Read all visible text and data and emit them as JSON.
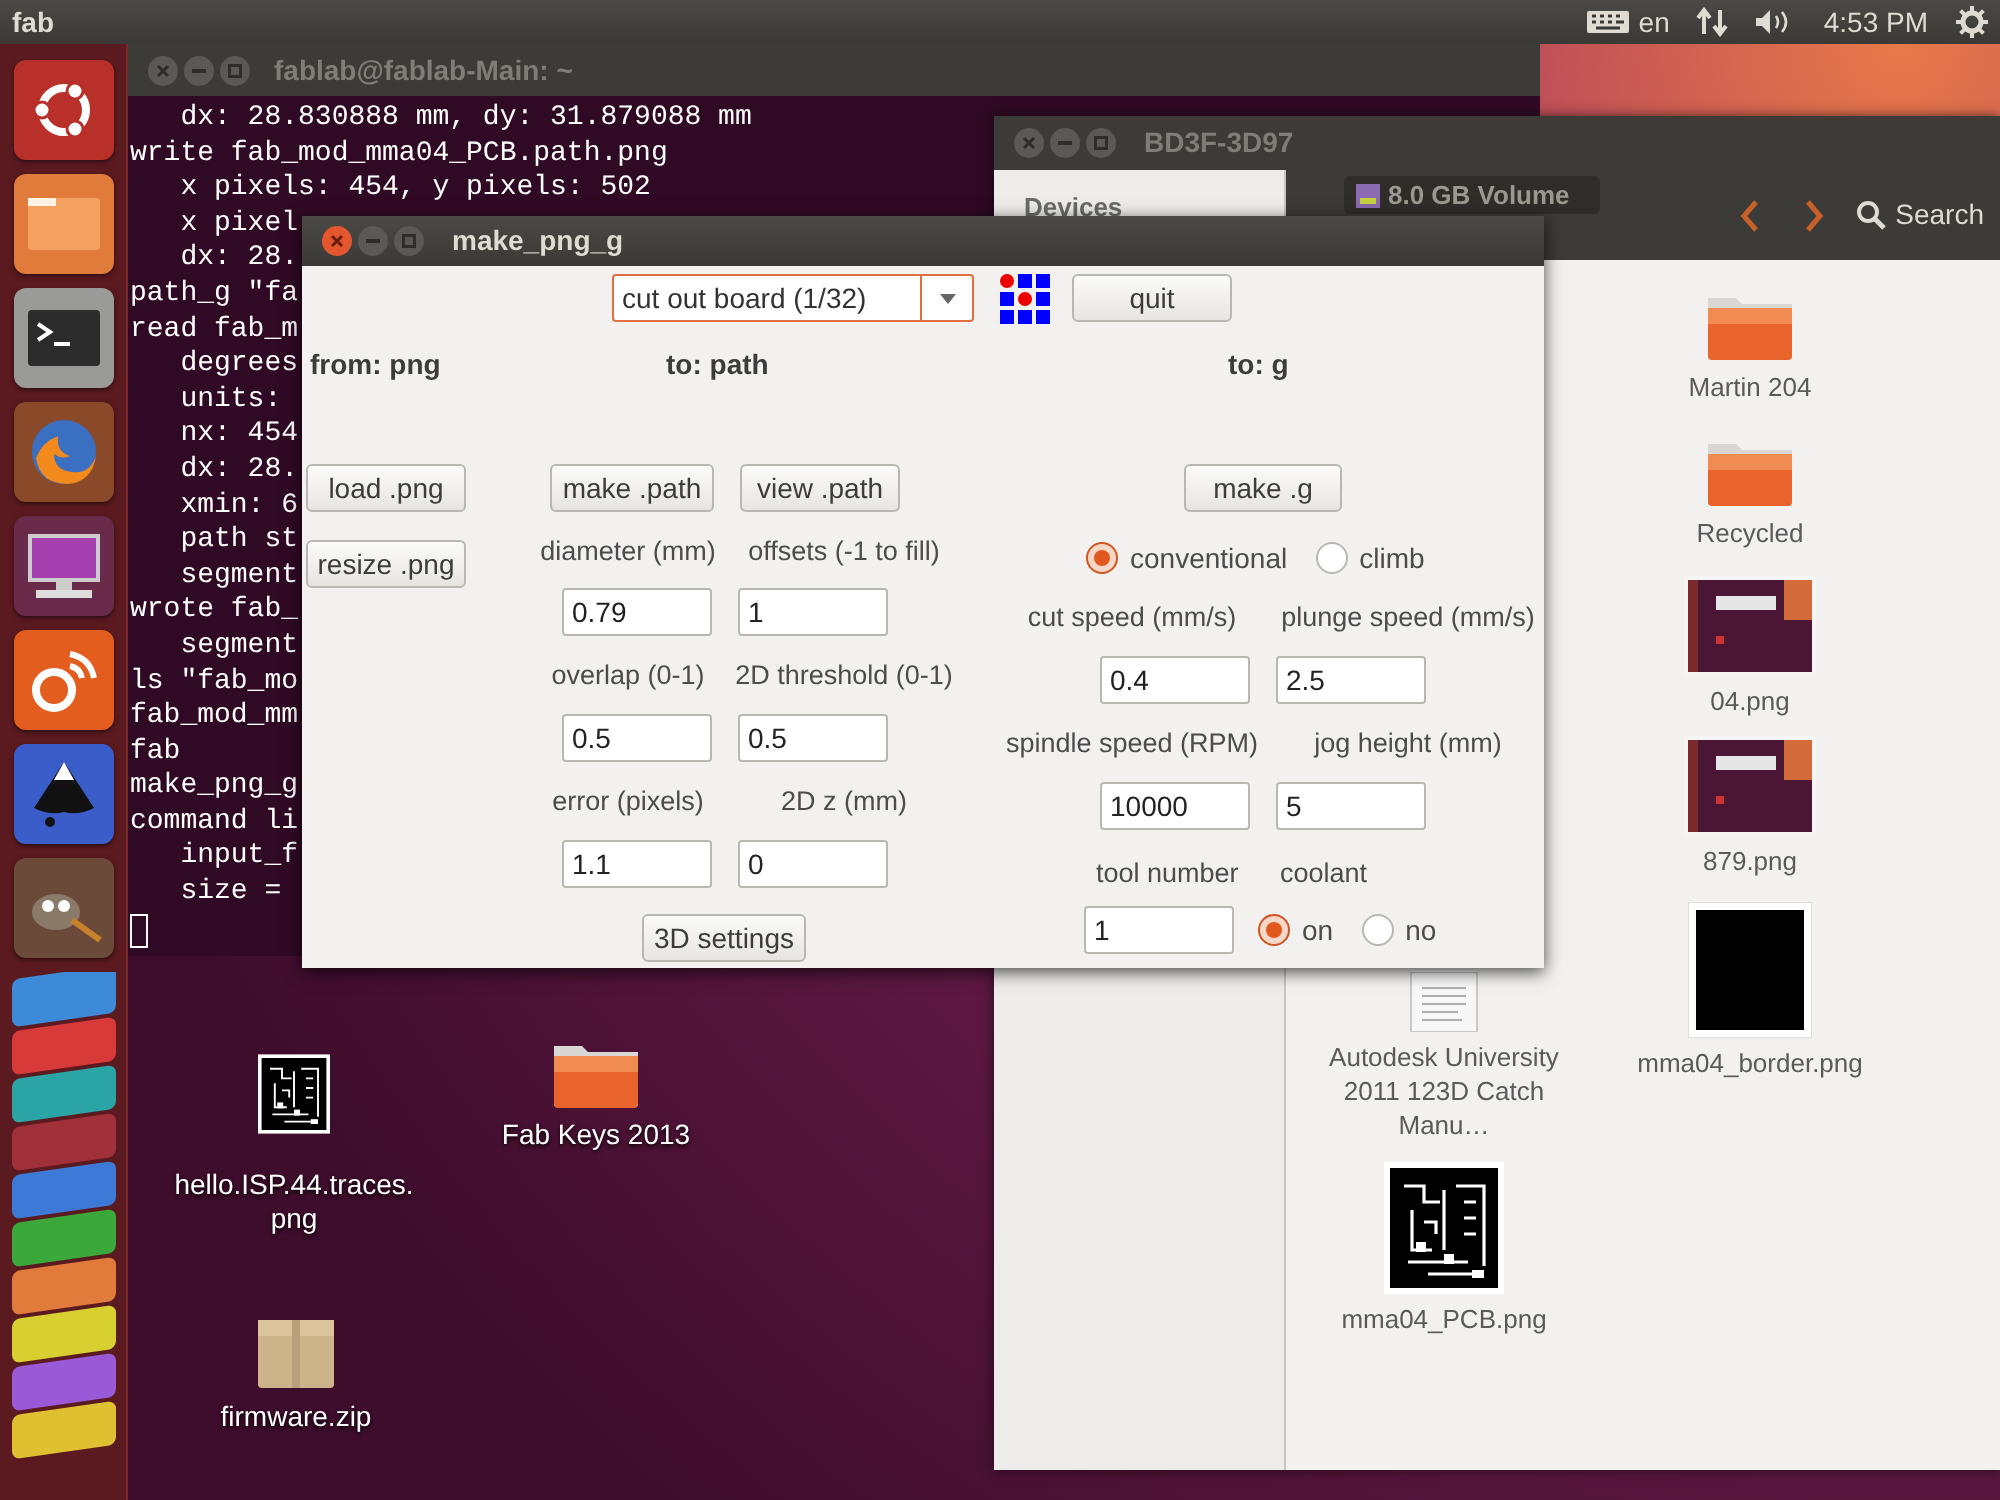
{
  "top_panel": {
    "title": "fab",
    "language": "en",
    "time": "4:53 PM"
  },
  "terminal": {
    "title": "fablab@fablab-Main: ~",
    "lines": [
      "   dx: 28.830888 mm, dy: 31.879088 mm",
      "write fab_mod_mma04_PCB.path.png",
      "   x pixels: 454, y pixels: 502",
      "   x pixel",
      "   dx: 28.",
      "path_g \"fa",
      "read fab_m",
      "   degrees",
      "   units:",
      "   nx: 454",
      "   dx: 28.",
      "   xmin: 6",
      "   path st",
      "   segment",
      "wrote fab_",
      "   segment",
      "ls \"fab_mo",
      "fab_mod_mm",
      "fab",
      "make_png_g",
      "command li",
      "   input_f",
      "   size ="
    ]
  },
  "file_manager": {
    "title": "BD3F-3D97",
    "sidebar_heading": "Devices",
    "location": "8.0 GB Volume",
    "search": "Search",
    "files": [
      {
        "name": "Martin 204",
        "kind": "folder"
      },
      {
        "name": "Recycled",
        "kind": "folder"
      },
      {
        "name": "04.png",
        "kind": "screenshot"
      },
      {
        "name": "879.png",
        "kind": "screenshot"
      },
      {
        "name": "Autodesk University 2011 123D Catch Manu…",
        "kind": "document"
      },
      {
        "name": "mma04_border.png",
        "kind": "black"
      },
      {
        "name": "mma04_PCB.png",
        "kind": "pcb"
      }
    ]
  },
  "desktop_icons": [
    {
      "name": "hello.ISP.44.traces.png",
      "kind": "pcb"
    },
    {
      "name": "Fab Keys 2013",
      "kind": "folder"
    },
    {
      "name": "firmware.zip",
      "kind": "archive"
    }
  ],
  "dialog": {
    "title": "make_png_g",
    "mode_select": "cut out board (1/32)",
    "quit_button": "quit",
    "headings": [
      "from: png",
      "to: path",
      "to: g"
    ],
    "load_button": "load .png",
    "resize_button": "resize .png",
    "make_path_button": "make .path",
    "view_path_button": "view .path",
    "make_g_button": "make .g",
    "settings_3d_button": "3D settings",
    "path_fields": [
      {
        "label": "diameter (mm)",
        "value": "0.79"
      },
      {
        "label": "offsets (-1 to fill)",
        "value": "1"
      },
      {
        "label": "overlap (0-1)",
        "value": "0.5"
      },
      {
        "label": "2D threshold (0-1)",
        "value": "0.5"
      },
      {
        "label": "error (pixels)",
        "value": "1.1"
      },
      {
        "label": "2D z (mm)",
        "value": "0"
      }
    ],
    "direction": [
      {
        "label": "conventional",
        "selected": true
      },
      {
        "label": "climb",
        "selected": false
      }
    ],
    "g_fields": [
      {
        "label": "cut speed (mm/s)",
        "value": "0.4"
      },
      {
        "label": "plunge speed (mm/s)",
        "value": "2.5"
      },
      {
        "label": "spindle speed (RPM)",
        "value": "10000"
      },
      {
        "label": "jog height (mm)",
        "value": "5"
      }
    ],
    "tool_number": {
      "label": "tool number",
      "value": "1"
    },
    "coolant": {
      "label": "coolant",
      "options": [
        {
          "label": "on",
          "selected": true
        },
        {
          "label": "no",
          "selected": false
        }
      ]
    }
  }
}
